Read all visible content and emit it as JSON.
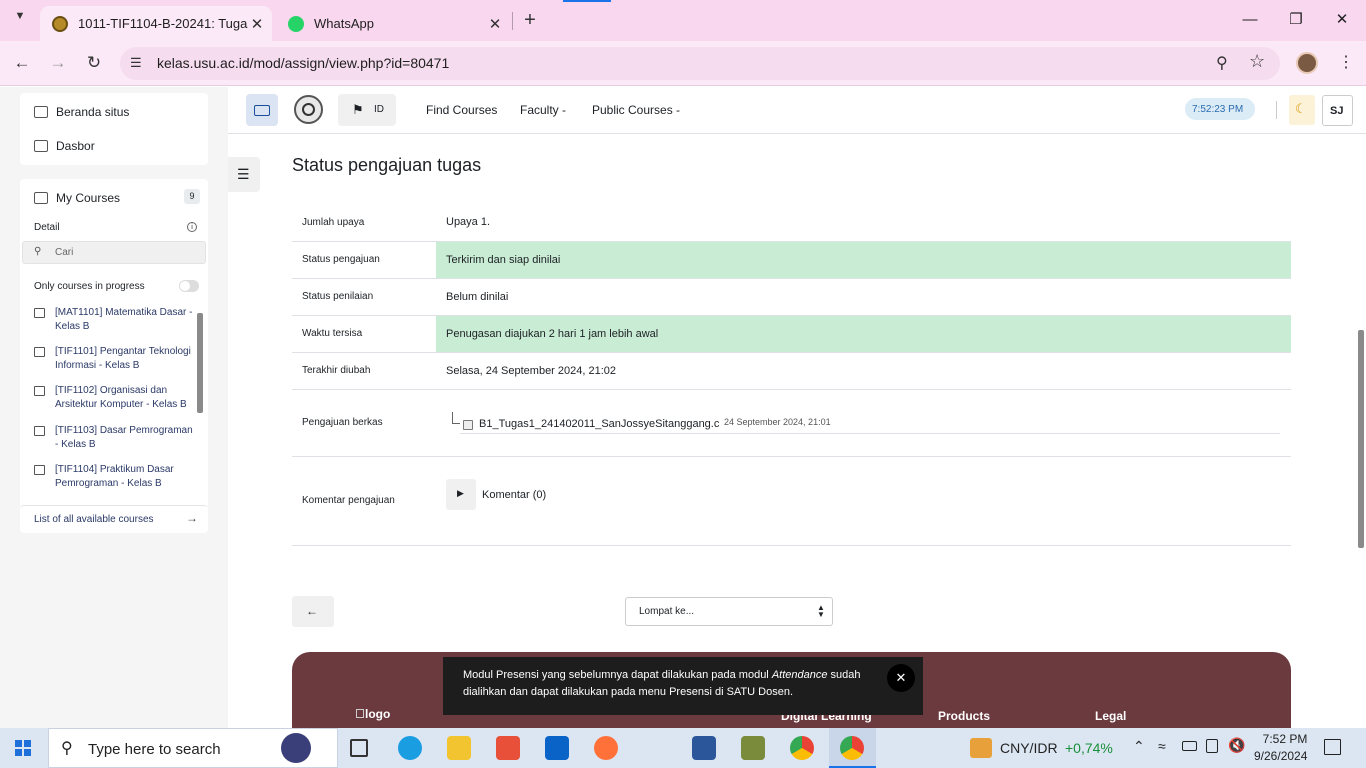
{
  "browser": {
    "tabs": [
      {
        "title": "1011-TIF1104-B-20241: Tugas 1",
        "active": true
      },
      {
        "title": "WhatsApp",
        "active": false
      }
    ],
    "url": "kelas.usu.ac.id/mod/assign/view.php?id=80471"
  },
  "drawer": {
    "home_label": "Beranda situs",
    "dashboard_label": "Dasbor",
    "my_courses_label": "My Courses",
    "my_courses_count": "9",
    "detail_label": "Detail",
    "search_placeholder": "Cari",
    "toggle_label": "Only courses in progress",
    "courses": [
      {
        "name": "[MAT1101] Matematika Dasar - Kelas B"
      },
      {
        "name": "[TIF1101] Pengantar Teknologi Informasi - Kelas B"
      },
      {
        "name": "[TIF1102] Organisasi dan Arsitektur Komputer - Kelas B"
      },
      {
        "name": "[TIF1103] Dasar Pemrograman - Kelas B"
      },
      {
        "name": "[TIF1104] Praktikum Dasar Pemrograman - Kelas B"
      }
    ],
    "all_courses_label": "List of all available courses"
  },
  "topnav": {
    "lang": "ID",
    "links": [
      "Find Courses",
      "Faculty -",
      "Public Courses -"
    ],
    "time": "7:52:23 PM",
    "user_initials": "SJ"
  },
  "main": {
    "heading": "Status pengajuan tugas",
    "rows": [
      {
        "label": "Jumlah upaya",
        "value": "Upaya 1."
      },
      {
        "label": "Status pengajuan",
        "value": "Terkirim dan siap dinilai"
      },
      {
        "label": "Status penilaian",
        "value": "Belum dinilai"
      },
      {
        "label": "Waktu tersisa",
        "value": "Penugasan diajukan 2 hari 1 jam lebih awal"
      },
      {
        "label": "Terakhir diubah",
        "value": "Selasa, 24 September 2024, 21:02"
      }
    ],
    "file_label": "Pengajuan berkas",
    "file_name": "B1_Tugas1_241402011_SanJossyeSitanggang.c",
    "file_date": "24 September 2024, 21:01",
    "comment_label": "Komentar pengajuan",
    "comment_link": "Komentar (0)",
    "jump_placeholder": "Lompat ke...",
    "toast_line1_pre": "Modul Presensi yang sebelumnya dapat dilakukan pada modul ",
    "toast_line1_em": "Attendance",
    "toast_line1_post": " sudah",
    "toast_line2": "dialihkan dan dapat dilakukan pada menu Presensi di SATU Dosen.",
    "footer_logo_alt": "logo",
    "footer_cols": [
      "Digital Learning",
      "Products",
      "Legal"
    ]
  },
  "taskbar": {
    "search_placeholder": "Type here to search",
    "ticker": "CNY/IDR",
    "ticker_change": "+0,74%",
    "clock_time": "7:52 PM",
    "clock_date": "9/26/2024"
  }
}
